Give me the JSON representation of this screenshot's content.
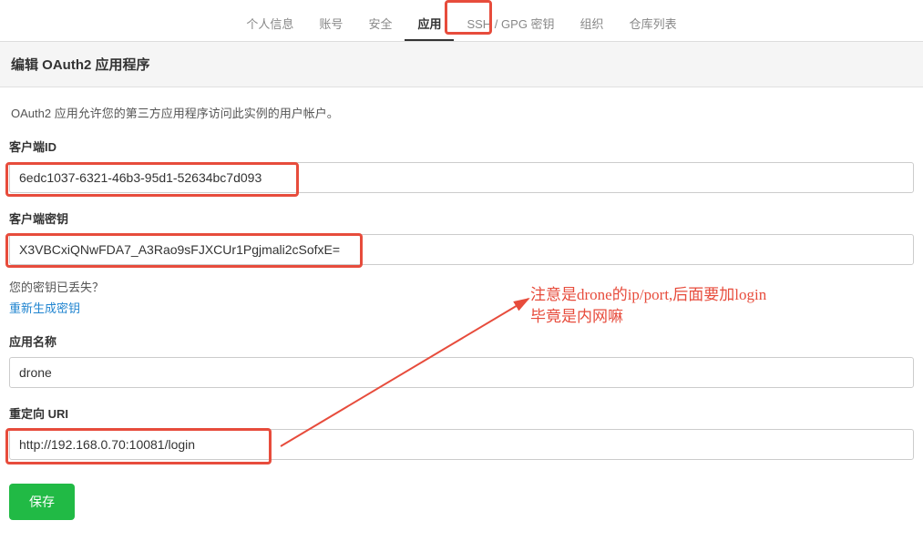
{
  "nav": {
    "items": [
      {
        "label": "个人信息",
        "active": false
      },
      {
        "label": "账号",
        "active": false
      },
      {
        "label": "安全",
        "active": false
      },
      {
        "label": "应用",
        "active": true
      },
      {
        "label": "SSH / GPG 密钥",
        "active": false
      },
      {
        "label": "组织",
        "active": false
      },
      {
        "label": "仓库列表",
        "active": false
      }
    ]
  },
  "page": {
    "title": "编辑 OAuth2 应用程序",
    "description": "OAuth2 应用允许您的第三方应用程序访问此实例的用户帐户。"
  },
  "form": {
    "client_id": {
      "label": "客户端ID",
      "value": "6edc1037-6321-46b3-95d1-52634bc7d093"
    },
    "client_secret": {
      "label": "客户端密钥",
      "value": "X3VBCxiQNwFDA7_A3Rao9sFJXCUr1Pgjmali2cSofxE="
    },
    "secret_lost_text": "您的密钥已丢失？",
    "regenerate_link": "重新生成密钥",
    "app_name": {
      "label": "应用名称",
      "value": "drone"
    },
    "redirect_uri": {
      "label": "重定向 URI",
      "value": "http://192.168.0.70:10081/login"
    },
    "save_label": "保存"
  },
  "annotation": {
    "line1": "注意是drone的ip/port,后面要加login",
    "line2": "毕竟是内网嘛"
  }
}
